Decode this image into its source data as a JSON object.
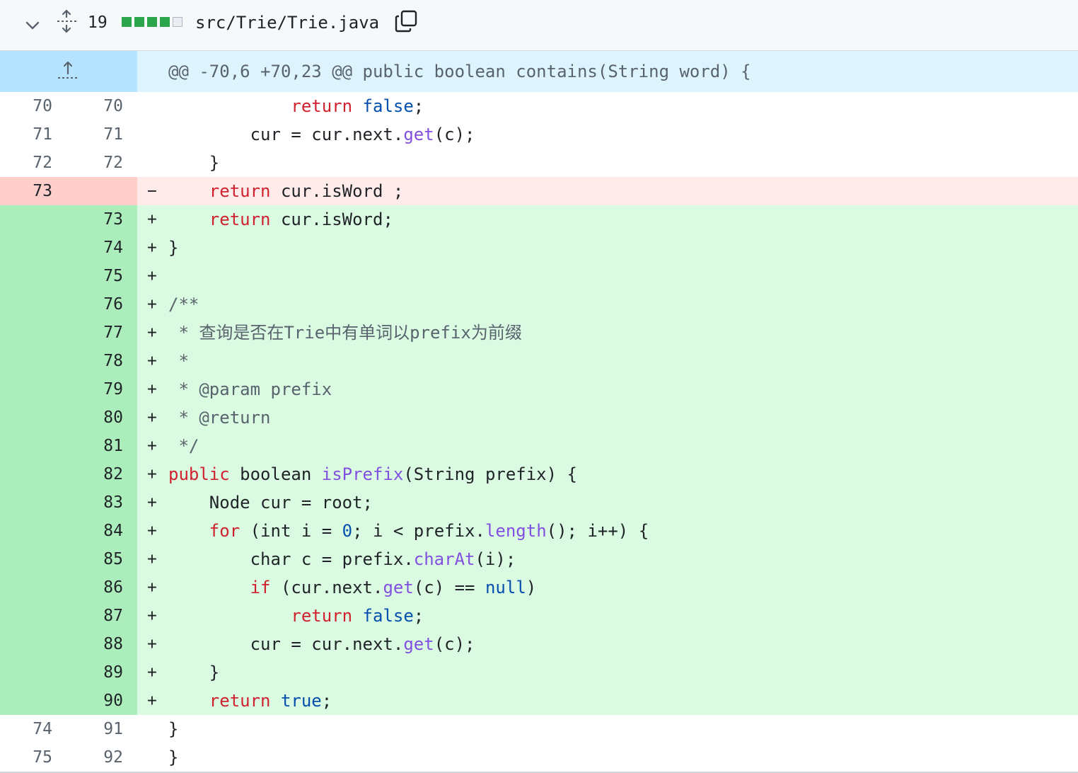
{
  "file_header": {
    "change_count": "19",
    "file_path": "src/Trie/Trie.java",
    "diffstat": [
      "add",
      "add",
      "add",
      "add",
      "neutral"
    ],
    "colors": {
      "add": "#2da44e",
      "neutral": "#eaeef2"
    },
    "icons": {
      "collapse": "chevron-down-icon",
      "expand": "expand-all-icon",
      "copy": "copy-icon"
    }
  },
  "hunk": {
    "header": "@@ -70,6 +70,23 @@ public boolean contains(String word) {",
    "icons": {
      "expand": "expand-up-icon"
    }
  },
  "diff": [
    {
      "type": "ctx",
      "old": "70",
      "new": "70",
      "marker": "",
      "tokens": [
        {
          "t": "            "
        },
        {
          "c": "kw",
          "t": "return"
        },
        {
          "t": " "
        },
        {
          "c": "cst",
          "t": "false"
        },
        {
          "t": ";"
        }
      ]
    },
    {
      "type": "ctx",
      "old": "71",
      "new": "71",
      "marker": "",
      "tokens": [
        {
          "t": "        cur = cur.next."
        },
        {
          "c": "fn",
          "t": "get"
        },
        {
          "t": "(c);"
        }
      ]
    },
    {
      "type": "ctx",
      "old": "72",
      "new": "72",
      "marker": "",
      "tokens": [
        {
          "t": "    }"
        }
      ]
    },
    {
      "type": "del",
      "old": "73",
      "new": "",
      "marker": "−",
      "tokens": [
        {
          "t": "    "
        },
        {
          "c": "kw",
          "t": "return"
        },
        {
          "t": " cur.isWord ;"
        }
      ]
    },
    {
      "type": "add",
      "old": "",
      "new": "73",
      "marker": "+",
      "tokens": [
        {
          "t": "    "
        },
        {
          "c": "kw",
          "t": "return"
        },
        {
          "t": " cur.isWord;"
        }
      ]
    },
    {
      "type": "add",
      "old": "",
      "new": "74",
      "marker": "+",
      "tokens": [
        {
          "t": "}"
        }
      ]
    },
    {
      "type": "add",
      "old": "",
      "new": "75",
      "marker": "+",
      "tokens": []
    },
    {
      "type": "add",
      "old": "",
      "new": "76",
      "marker": "+",
      "tokens": [
        {
          "c": "cm",
          "t": "/**"
        }
      ]
    },
    {
      "type": "add",
      "old": "",
      "new": "77",
      "marker": "+",
      "tokens": [
        {
          "c": "cm",
          "t": " * 查询是否在Trie中有单词以prefix为前缀"
        }
      ]
    },
    {
      "type": "add",
      "old": "",
      "new": "78",
      "marker": "+",
      "tokens": [
        {
          "c": "cm",
          "t": " *"
        }
      ]
    },
    {
      "type": "add",
      "old": "",
      "new": "79",
      "marker": "+",
      "tokens": [
        {
          "c": "cm",
          "t": " * @param prefix"
        }
      ]
    },
    {
      "type": "add",
      "old": "",
      "new": "80",
      "marker": "+",
      "tokens": [
        {
          "c": "cm",
          "t": " * @return"
        }
      ]
    },
    {
      "type": "add",
      "old": "",
      "new": "81",
      "marker": "+",
      "tokens": [
        {
          "c": "cm",
          "t": " */"
        }
      ]
    },
    {
      "type": "add",
      "old": "",
      "new": "82",
      "marker": "+",
      "tokens": [
        {
          "c": "kw",
          "t": "public"
        },
        {
          "t": " boolean "
        },
        {
          "c": "fn",
          "t": "isPrefix"
        },
        {
          "t": "(String prefix) {"
        }
      ]
    },
    {
      "type": "add",
      "old": "",
      "new": "83",
      "marker": "+",
      "tokens": [
        {
          "t": "    Node cur = root;"
        }
      ]
    },
    {
      "type": "add",
      "old": "",
      "new": "84",
      "marker": "+",
      "tokens": [
        {
          "t": "    "
        },
        {
          "c": "kw",
          "t": "for"
        },
        {
          "t": " (int i = "
        },
        {
          "c": "cst",
          "t": "0"
        },
        {
          "t": "; i < prefix."
        },
        {
          "c": "fn",
          "t": "length"
        },
        {
          "t": "(); i++) {"
        }
      ]
    },
    {
      "type": "add",
      "old": "",
      "new": "85",
      "marker": "+",
      "tokens": [
        {
          "t": "        char c = prefix."
        },
        {
          "c": "fn",
          "t": "charAt"
        },
        {
          "t": "(i);"
        }
      ]
    },
    {
      "type": "add",
      "old": "",
      "new": "86",
      "marker": "+",
      "tokens": [
        {
          "t": "        "
        },
        {
          "c": "kw",
          "t": "if"
        },
        {
          "t": " (cur.next."
        },
        {
          "c": "fn",
          "t": "get"
        },
        {
          "t": "(c) == "
        },
        {
          "c": "cst",
          "t": "null"
        },
        {
          "t": ")"
        }
      ]
    },
    {
      "type": "add",
      "old": "",
      "new": "87",
      "marker": "+",
      "tokens": [
        {
          "t": "            "
        },
        {
          "c": "kw",
          "t": "return"
        },
        {
          "t": " "
        },
        {
          "c": "cst",
          "t": "false"
        },
        {
          "t": ";"
        }
      ]
    },
    {
      "type": "add",
      "old": "",
      "new": "88",
      "marker": "+",
      "tokens": [
        {
          "t": "        cur = cur.next."
        },
        {
          "c": "fn",
          "t": "get"
        },
        {
          "t": "(c);"
        }
      ]
    },
    {
      "type": "add",
      "old": "",
      "new": "89",
      "marker": "+",
      "tokens": [
        {
          "t": "    }"
        }
      ]
    },
    {
      "type": "add",
      "old": "",
      "new": "90",
      "marker": "+",
      "tokens": [
        {
          "t": "    "
        },
        {
          "c": "kw",
          "t": "return"
        },
        {
          "t": " "
        },
        {
          "c": "cst",
          "t": "true"
        },
        {
          "t": ";"
        }
      ]
    },
    {
      "type": "ctx",
      "old": "74",
      "new": "91",
      "marker": "",
      "tokens": [
        {
          "t": "}"
        }
      ]
    },
    {
      "type": "ctx",
      "old": "75",
      "new": "92",
      "marker": "",
      "tokens": [
        {
          "t": "}"
        }
      ]
    }
  ]
}
